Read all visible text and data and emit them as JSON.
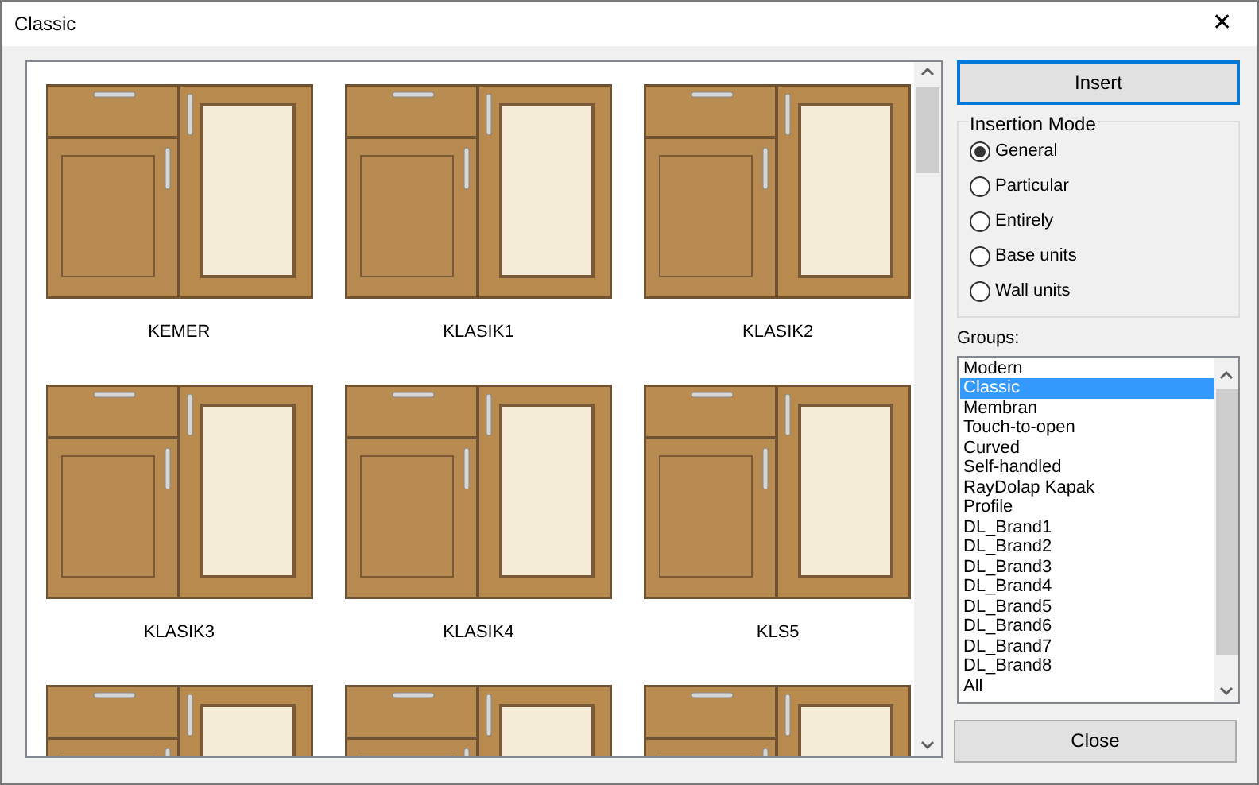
{
  "window": {
    "title": "Classic",
    "close": "✕"
  },
  "gallery": {
    "items": [
      {
        "kind": "full",
        "label": "KEMER"
      },
      {
        "kind": "full",
        "label": "KLASIK1"
      },
      {
        "kind": "full",
        "label": "KLASIK2"
      },
      {
        "kind": "full",
        "label": "KLASIK3"
      },
      {
        "kind": "full",
        "label": "KLASIK4"
      },
      {
        "kind": "full",
        "label": "KLS5"
      },
      {
        "kind": "cut"
      },
      {
        "kind": "cut"
      },
      {
        "kind": "cut"
      }
    ]
  },
  "insert_button": "Insert",
  "insertion_mode": {
    "title": "Insertion Mode",
    "options": [
      {
        "label": "General",
        "selected": true
      },
      {
        "label": "Particular",
        "selected": false
      },
      {
        "label": "Entirely",
        "selected": false
      },
      {
        "label": "Base units",
        "selected": false
      },
      {
        "label": "Wall units",
        "selected": false
      }
    ]
  },
  "groups": {
    "label": "Groups:",
    "items": [
      {
        "label": "Modern",
        "selected": false
      },
      {
        "label": "Classic",
        "selected": true
      },
      {
        "label": "Membran",
        "selected": false
      },
      {
        "label": "Touch-to-open",
        "selected": false
      },
      {
        "label": "Curved",
        "selected": false
      },
      {
        "label": "Self-handled",
        "selected": false
      },
      {
        "label": "RayDolap Kapak",
        "selected": false
      },
      {
        "label": "Profile",
        "selected": false
      },
      {
        "label": "DL_Brand1",
        "selected": false
      },
      {
        "label": "DL_Brand2",
        "selected": false
      },
      {
        "label": "DL_Brand3",
        "selected": false
      },
      {
        "label": "DL_Brand4",
        "selected": false
      },
      {
        "label": "DL_Brand5",
        "selected": false
      },
      {
        "label": "DL_Brand6",
        "selected": false
      },
      {
        "label": "DL_Brand7",
        "selected": false
      },
      {
        "label": "DL_Brand8",
        "selected": false
      },
      {
        "label": "All",
        "selected": false
      }
    ]
  },
  "close_button": "Close"
}
